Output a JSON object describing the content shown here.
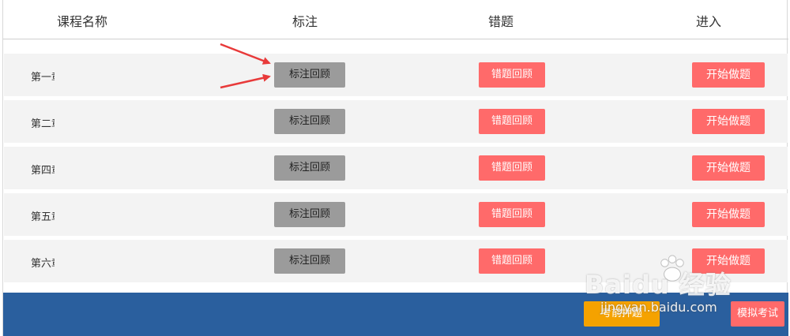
{
  "header": {
    "col_name": "课程名称",
    "col_mark": "标注",
    "col_error": "错题",
    "col_enter": "进入"
  },
  "rows": [
    {
      "title": "第一章",
      "mark_label": "标注回顾",
      "error_label": "错题回顾",
      "start_label": "开始做题"
    },
    {
      "title": "第二章",
      "mark_label": "标注回顾",
      "error_label": "错题回顾",
      "start_label": "开始做题"
    },
    {
      "title": "第四章",
      "mark_label": "标注回顾",
      "error_label": "错题回顾",
      "start_label": "开始做题"
    },
    {
      "title": "第五章",
      "mark_label": "标注回顾",
      "error_label": "错题回顾",
      "start_label": "开始做题"
    },
    {
      "title": "第六章",
      "mark_label": "标注回顾",
      "error_label": "错题回顾",
      "start_label": "开始做题"
    }
  ],
  "footer": {
    "review_label": "考前押题",
    "mock_label": "模拟考试"
  },
  "watermark": {
    "logo": "Baidu 经验",
    "url": "jingyan.baidu.com"
  },
  "colors": {
    "mark_button": "#9b9b9b",
    "error_button": "#ff6a6a",
    "start_button": "#ff6a6a",
    "footer_bar": "#2a5f9e",
    "review_button": "#f5a200",
    "annotation_arrow": "#e83a3a"
  }
}
